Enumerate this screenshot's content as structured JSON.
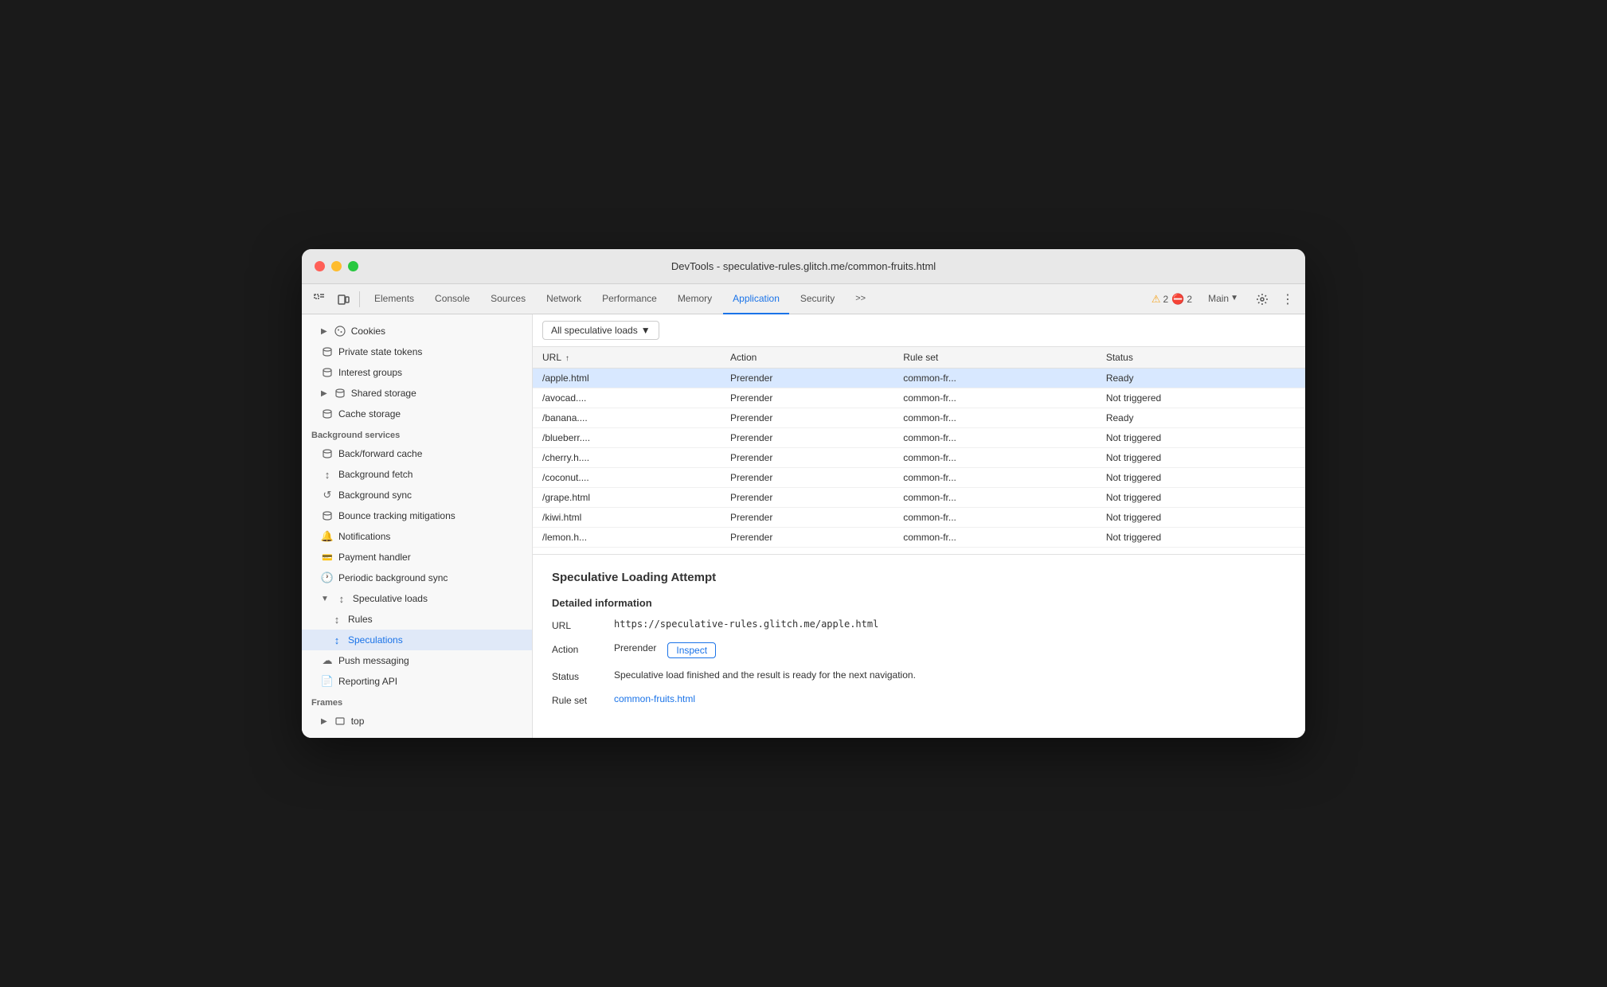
{
  "window": {
    "title": "DevTools - speculative-rules.glitch.me/common-fruits.html"
  },
  "toolbar": {
    "tabs": [
      {
        "id": "elements",
        "label": "Elements"
      },
      {
        "id": "console",
        "label": "Console"
      },
      {
        "id": "sources",
        "label": "Sources"
      },
      {
        "id": "network",
        "label": "Network"
      },
      {
        "id": "performance",
        "label": "Performance"
      },
      {
        "id": "memory",
        "label": "Memory"
      },
      {
        "id": "application",
        "label": "Application",
        "active": true
      },
      {
        "id": "security",
        "label": "Security"
      }
    ],
    "warnings_count": "2",
    "errors_count": "2",
    "main_label": "Main",
    "more_tabs": ">>"
  },
  "sidebar": {
    "cookies_label": "Cookies",
    "private_state_tokens_label": "Private state tokens",
    "interest_groups_label": "Interest groups",
    "shared_storage_label": "Shared storage",
    "cache_storage_label": "Cache storage",
    "bg_services_label": "Background services",
    "back_forward_cache_label": "Back/forward cache",
    "background_fetch_label": "Background fetch",
    "background_sync_label": "Background sync",
    "bounce_tracking_label": "Bounce tracking mitigations",
    "notifications_label": "Notifications",
    "payment_handler_label": "Payment handler",
    "periodic_bg_sync_label": "Periodic background sync",
    "speculative_loads_label": "Speculative loads",
    "rules_label": "Rules",
    "speculations_label": "Speculations",
    "push_messaging_label": "Push messaging",
    "reporting_api_label": "Reporting API",
    "frames_label": "Frames",
    "top_label": "top"
  },
  "filter": {
    "dropdown_label": "All speculative loads",
    "dropdown_arrow": "▼"
  },
  "table": {
    "columns": [
      "URL",
      "Action",
      "Rule set",
      "Status"
    ],
    "rows": [
      {
        "url": "/apple.html",
        "action": "Prerender",
        "rule_set": "common-fr...",
        "status": "Ready",
        "selected": true
      },
      {
        "url": "/avocad....",
        "action": "Prerender",
        "rule_set": "common-fr...",
        "status": "Not triggered",
        "selected": false
      },
      {
        "url": "/banana....",
        "action": "Prerender",
        "rule_set": "common-fr...",
        "status": "Ready",
        "selected": false
      },
      {
        "url": "/blueberr....",
        "action": "Prerender",
        "rule_set": "common-fr...",
        "status": "Not triggered",
        "selected": false
      },
      {
        "url": "/cherry.h....",
        "action": "Prerender",
        "rule_set": "common-fr...",
        "status": "Not triggered",
        "selected": false
      },
      {
        "url": "/coconut....",
        "action": "Prerender",
        "rule_set": "common-fr...",
        "status": "Not triggered",
        "selected": false
      },
      {
        "url": "/grape.html",
        "action": "Prerender",
        "rule_set": "common-fr...",
        "status": "Not triggered",
        "selected": false
      },
      {
        "url": "/kiwi.html",
        "action": "Prerender",
        "rule_set": "common-fr...",
        "status": "Not triggered",
        "selected": false
      },
      {
        "url": "/lemon.h...",
        "action": "Prerender",
        "rule_set": "common-fr...",
        "status": "Not triggered",
        "selected": false
      }
    ]
  },
  "detail": {
    "title": "Speculative Loading Attempt",
    "section_title": "Detailed information",
    "url_label": "URL",
    "url_value": "https://speculative-rules.glitch.me/apple.html",
    "action_label": "Action",
    "action_value": "Prerender",
    "inspect_label": "Inspect",
    "status_label": "Status",
    "status_value": "Speculative load finished and the result is ready for the next navigation.",
    "rule_set_label": "Rule set",
    "rule_set_link": "common-fruits.html"
  }
}
